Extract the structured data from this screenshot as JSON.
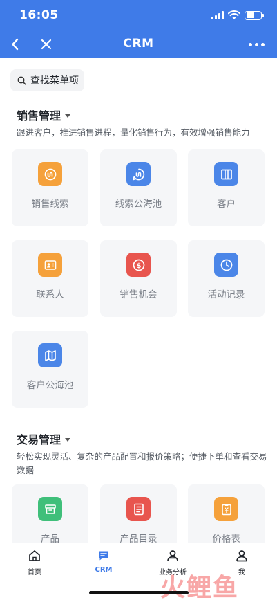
{
  "status_bar": {
    "time": "16:05"
  },
  "nav": {
    "title": "CRM"
  },
  "search": {
    "label": "查找菜单项"
  },
  "sections": [
    {
      "title": "销售管理",
      "description": "跟进客户，推进销售进程，量化销售行为，有效增强销售能力",
      "items": [
        {
          "label": "销售线索",
          "icon": "lead-icon",
          "color": "#f5a13b"
        },
        {
          "label": "线索公海池",
          "icon": "lead-pool-icon",
          "color": "#4b86e8"
        },
        {
          "label": "客户",
          "icon": "building-icon",
          "color": "#4b86e8"
        },
        {
          "label": "联系人",
          "icon": "contact-card-icon",
          "color": "#f5a13b"
        },
        {
          "label": "销售机会",
          "icon": "dollar-icon",
          "color": "#e8554e"
        },
        {
          "label": "活动记录",
          "icon": "clock-icon",
          "color": "#4b86e8"
        },
        {
          "label": "客户公海池",
          "icon": "map-icon",
          "color": "#4b86e8"
        }
      ]
    },
    {
      "title": "交易管理",
      "description": "轻松实现灵活、复杂的产品配置和报价策略；便捷下单和查看交易数据",
      "items": [
        {
          "label": "产品",
          "icon": "product-box-icon",
          "color": "#3fbf7a"
        },
        {
          "label": "产品目录",
          "icon": "catalog-icon",
          "color": "#e8554e"
        },
        {
          "label": "价格表",
          "icon": "price-list-icon",
          "color": "#f5a13b"
        }
      ]
    }
  ],
  "tabbar": {
    "tabs": [
      {
        "label": "首页",
        "icon": "home-icon",
        "active": false
      },
      {
        "label": "CRM",
        "icon": "chat-icon",
        "active": true
      },
      {
        "label": "业务分析",
        "icon": "user-analysis-icon",
        "active": false
      },
      {
        "label": "我",
        "icon": "user-icon",
        "active": false
      }
    ],
    "active_color": "#3f7be8"
  },
  "watermark": {
    "text": "火鲤鱼"
  },
  "colors": {
    "brand": "#3f7be8",
    "tile_bg": "#f5f6f8"
  }
}
